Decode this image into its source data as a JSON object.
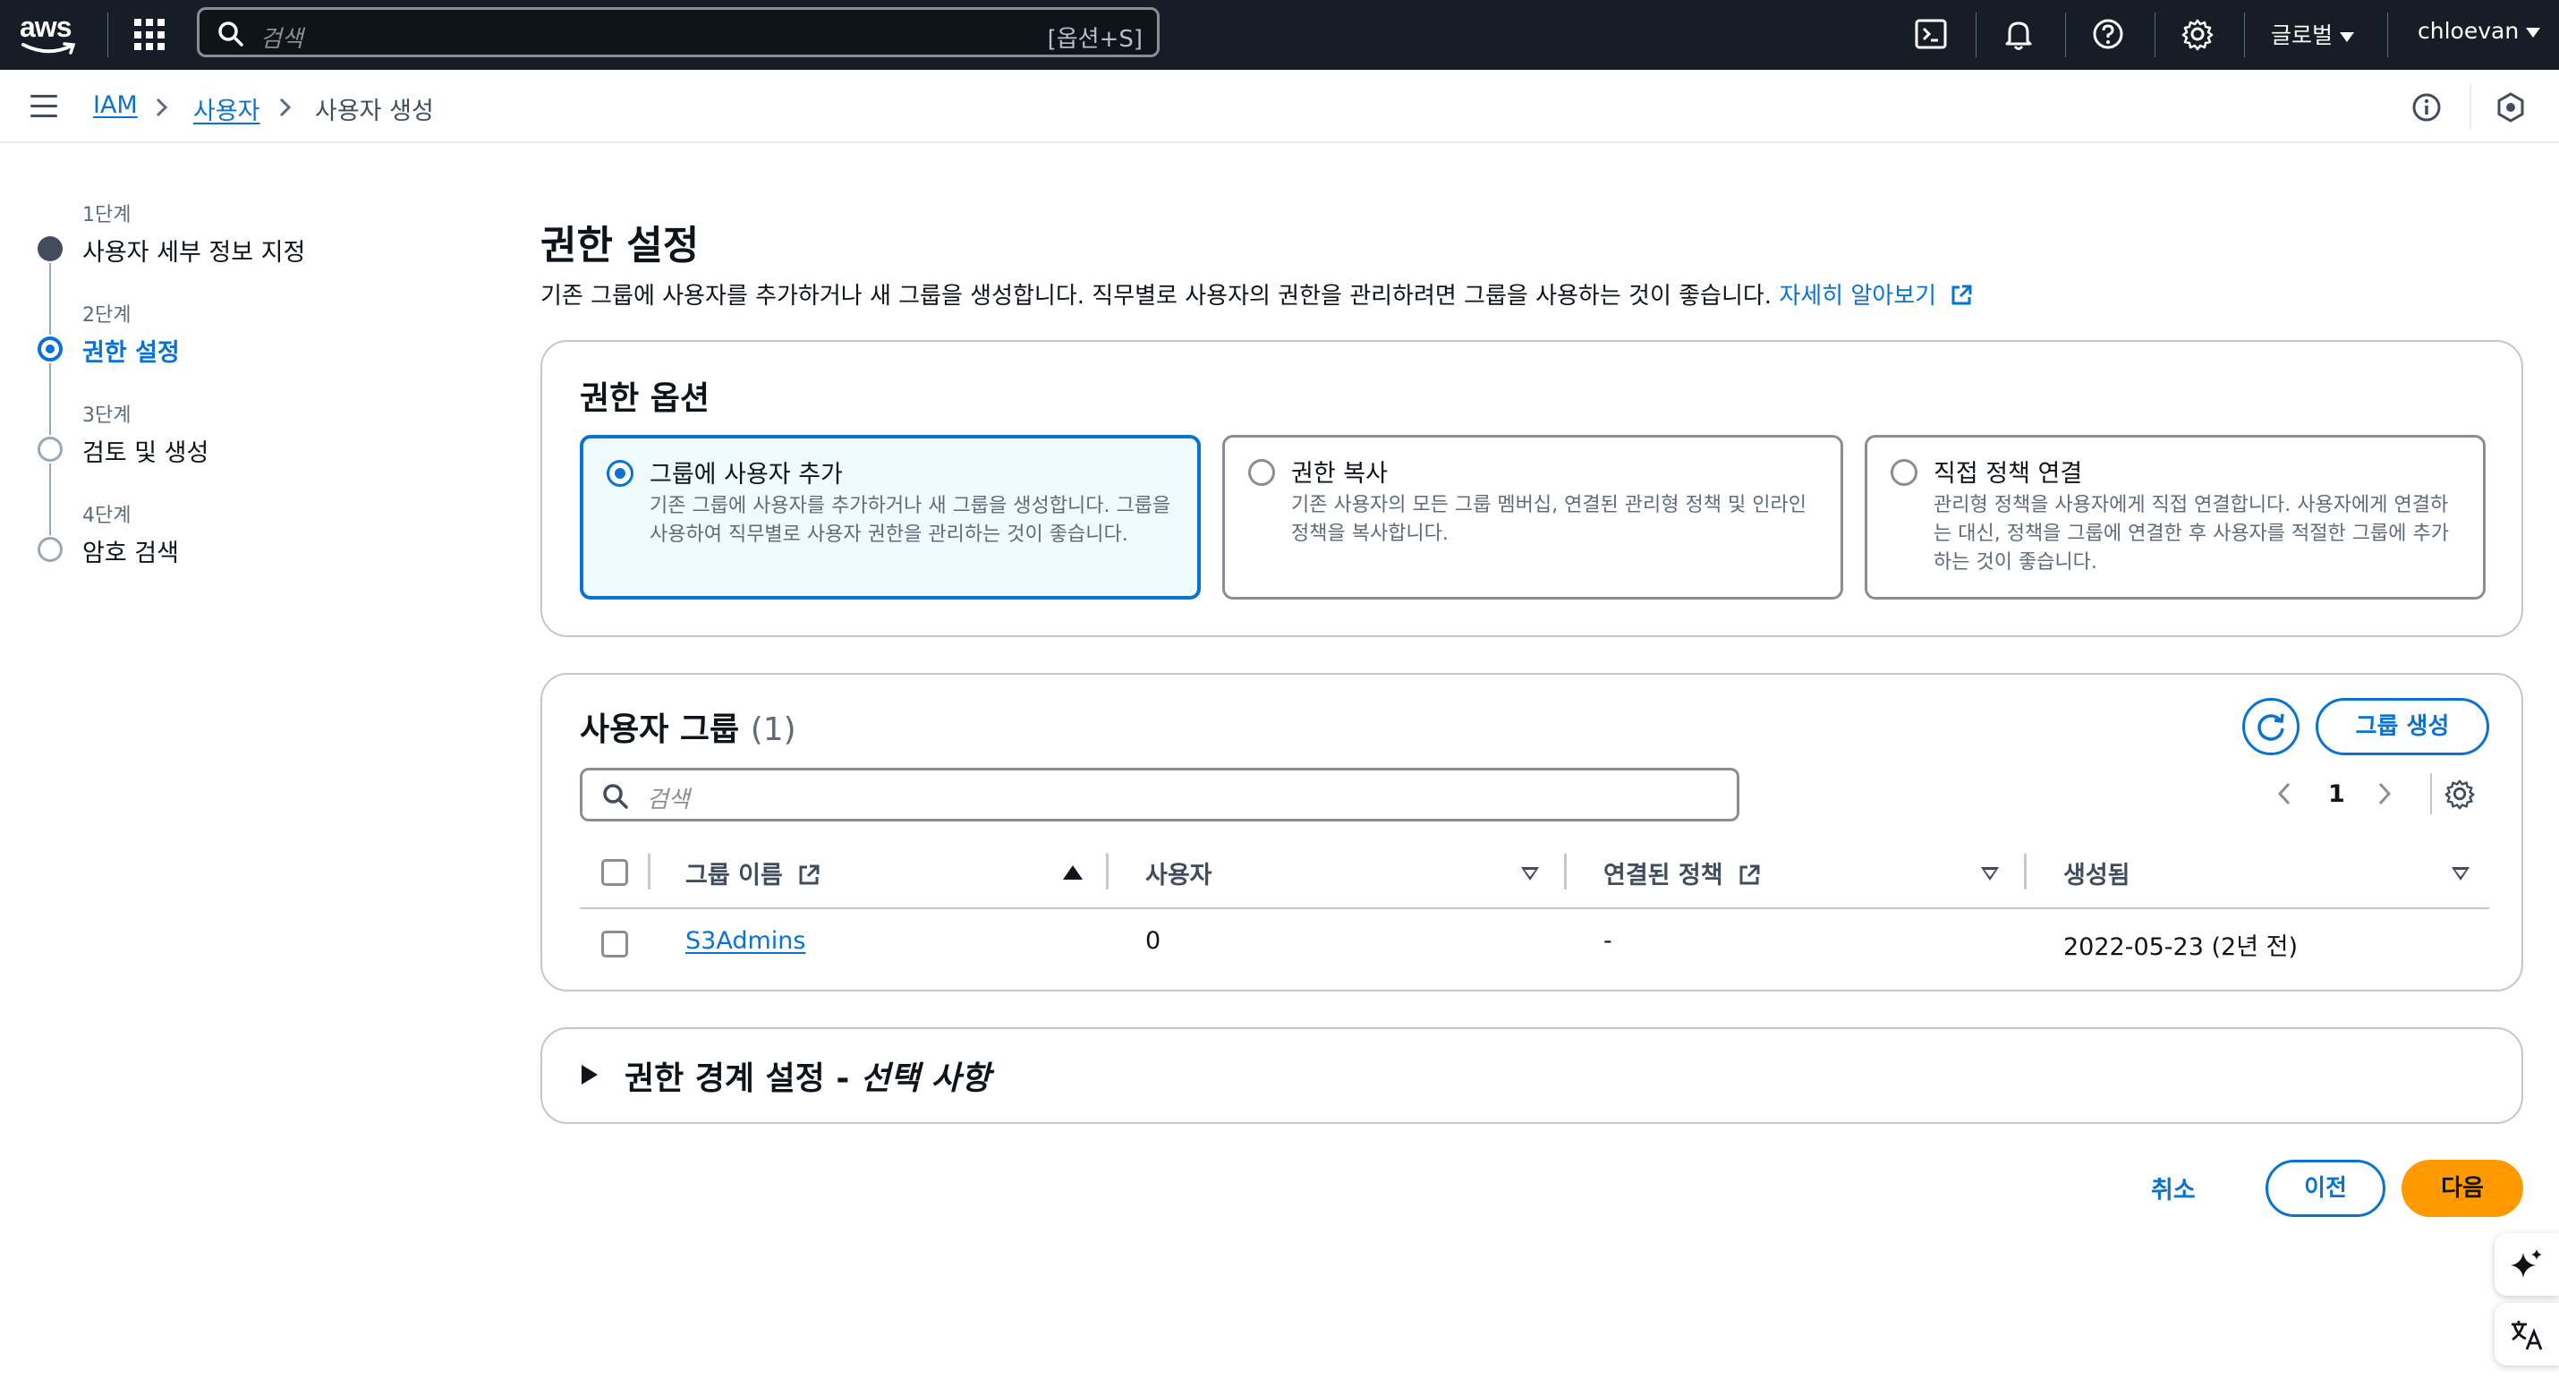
{
  "topnav": {
    "logo": "aws",
    "search_placeholder": "검색",
    "search_shortcut": "[옵션+S]",
    "region_label": "글로벌",
    "user_label": "chloevan",
    "icons": [
      "cloudshell-icon",
      "bell-icon",
      "help-icon",
      "settings-icon"
    ]
  },
  "breadcrumb": {
    "items": [
      "IAM",
      "사용자",
      "사용자 생성"
    ]
  },
  "steps": [
    {
      "step": "1단계",
      "label": "사용자 세부 정보 지정",
      "state": "completed"
    },
    {
      "step": "2단계",
      "label": "권한 설정",
      "state": "active"
    },
    {
      "step": "3단계",
      "label": "검토 및 생성",
      "state": "pending"
    },
    {
      "step": "4단계",
      "label": "암호 검색",
      "state": "pending"
    }
  ],
  "page": {
    "title": "권한 설정",
    "description": "기존 그룹에 사용자를 추가하거나 새 그룹을 생성합니다. 직무별로 사용자의 권한을 관리하려면 그룹을 사용하는 것이 좋습니다.",
    "learn_more": "자세히 알아보기"
  },
  "permission_options": {
    "title": "권한 옵션",
    "tiles": [
      {
        "title": "그룹에 사용자 추가",
        "description": "기존 그룹에 사용자를 추가하거나 새 그룹을 생성합니다. 그룹을 사용하여 직무별로 사용자 권한을 관리하는 것이 좋습니다.",
        "selected": true
      },
      {
        "title": "권한 복사",
        "description": "기존 사용자의 모든 그룹 멤버십, 연결된 관리형 정책 및 인라인 정책을 복사합니다.",
        "selected": false
      },
      {
        "title": "직접 정책 연결",
        "description": "관리형 정책을 사용자에게 직접 연결합니다. 사용자에게 연결하는 대신, 정책을 그룹에 연결한 후 사용자를 적절한 그룹에 추가하는 것이 좋습니다.",
        "selected": false
      }
    ]
  },
  "user_groups": {
    "title": "사용자 그룹",
    "count": "(1)",
    "create_button": "그룹 생성",
    "search_placeholder": "검색",
    "page_number": "1",
    "columns": [
      "그룹 이름",
      "사용자",
      "연결된 정책",
      "생성됨"
    ],
    "rows": [
      {
        "name": "S3Admins",
        "users": "0",
        "policies": "-",
        "created": "2022-05-23 (2년 전)"
      }
    ]
  },
  "boundary": {
    "title": "권한 경계 설정 - ",
    "optional": "선택 사항"
  },
  "footer": {
    "cancel": "취소",
    "previous": "이전",
    "next": "다음"
  },
  "colors": {
    "nav_bg": "#161d26",
    "link": "#0972d3",
    "primary_button": "#ff9900"
  }
}
